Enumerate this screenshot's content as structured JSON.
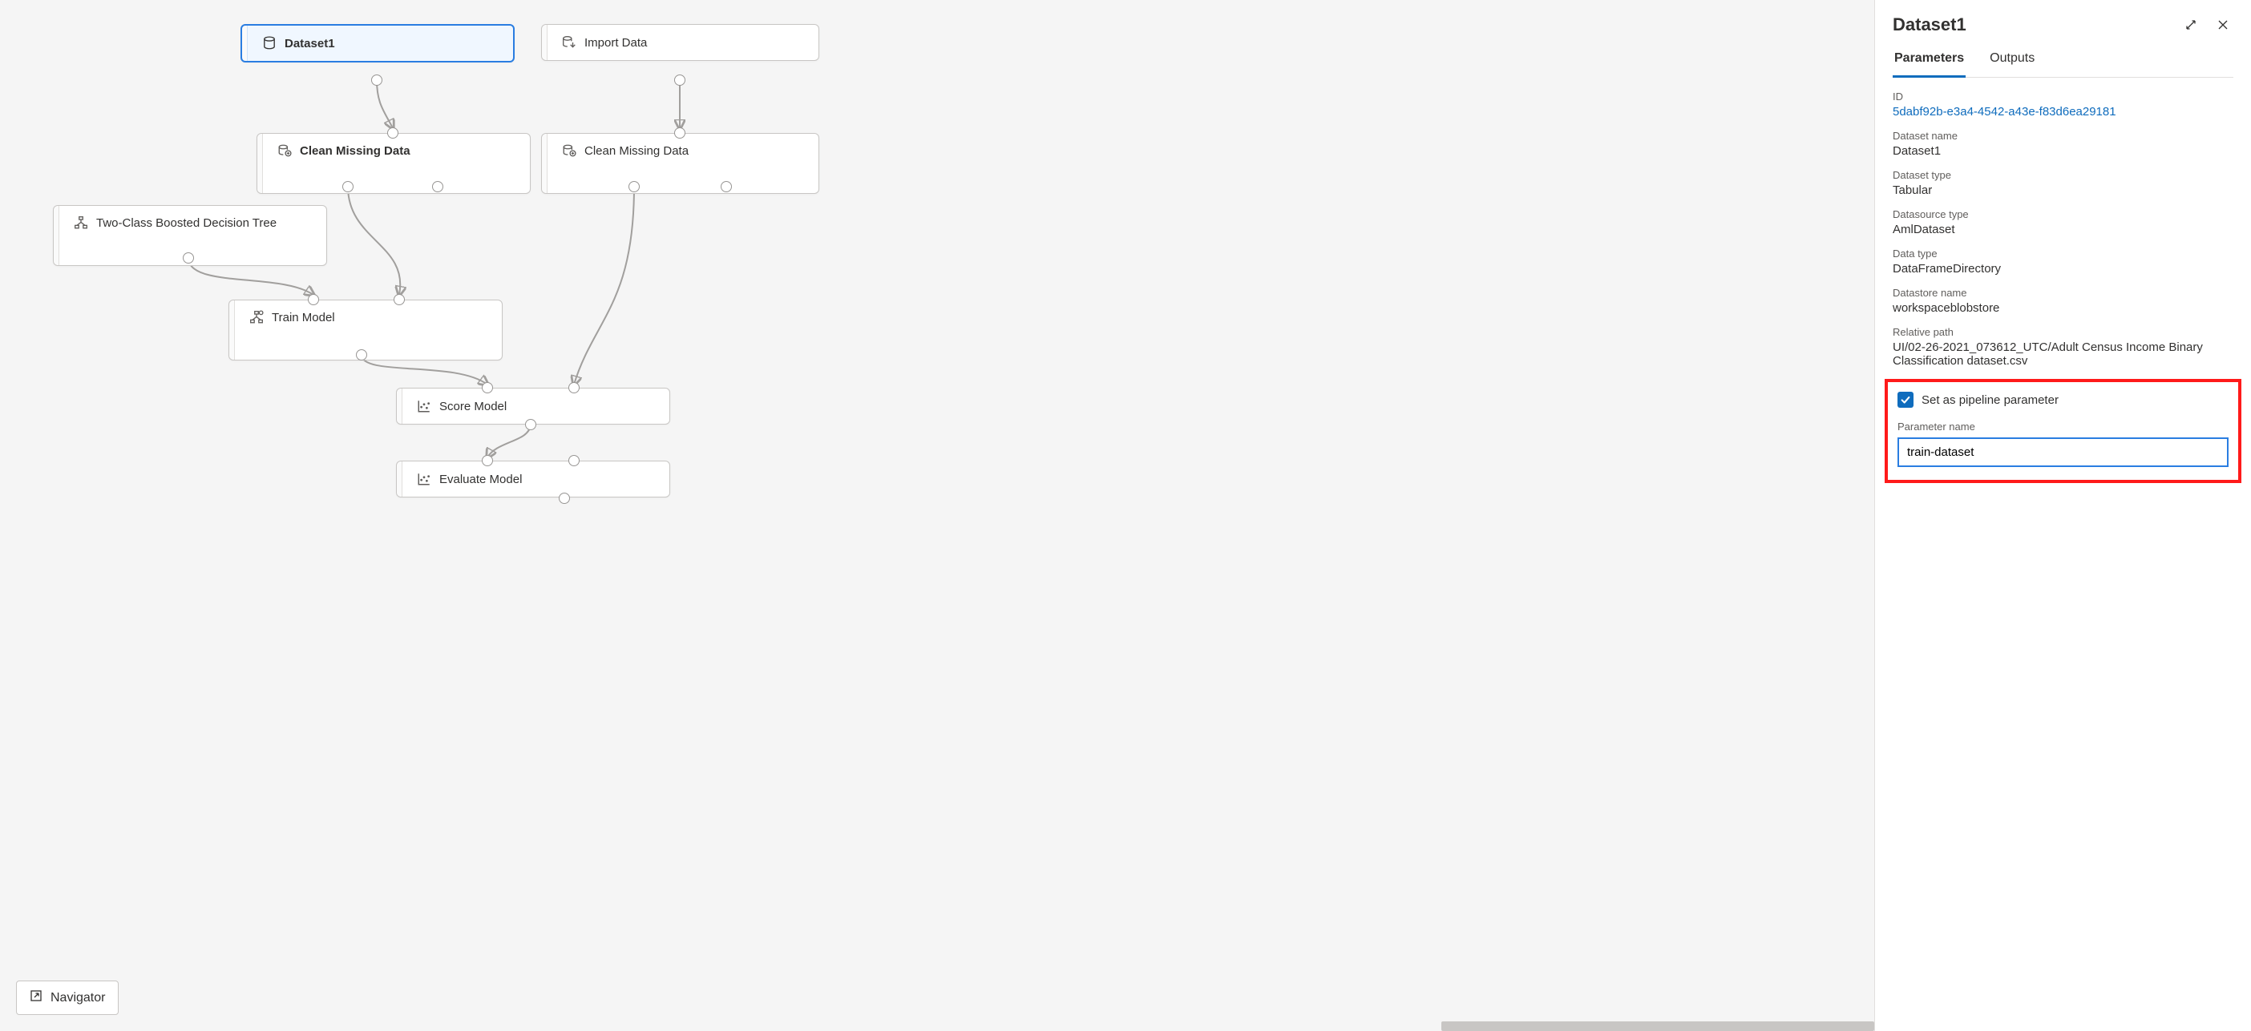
{
  "canvas": {
    "nodes": {
      "dataset1": {
        "label": "Dataset1",
        "icon": "dataset"
      },
      "importData": {
        "label": "Import Data",
        "icon": "import"
      },
      "cleanLeft": {
        "label": "Clean Missing Data",
        "icon": "clean"
      },
      "cleanRight": {
        "label": "Clean Missing Data",
        "icon": "clean"
      },
      "twoClass": {
        "label": "Two-Class Boosted Decision Tree",
        "icon": "tree"
      },
      "trainModel": {
        "label": "Train Model",
        "icon": "train"
      },
      "scoreModel": {
        "label": "Score Model",
        "icon": "chart"
      },
      "evalModel": {
        "label": "Evaluate Model",
        "icon": "chart"
      }
    },
    "navigator_label": "Navigator"
  },
  "panel": {
    "title": "Dataset1",
    "tabs": {
      "parameters": "Parameters",
      "outputs": "Outputs"
    },
    "props": {
      "id": {
        "k": "ID",
        "v": "5dabf92b-e3a4-4542-a43e-f83d6ea29181"
      },
      "datasetName": {
        "k": "Dataset name",
        "v": "Dataset1"
      },
      "datasetType": {
        "k": "Dataset type",
        "v": "Tabular"
      },
      "datasourceType": {
        "k": "Datasource type",
        "v": "AmlDataset"
      },
      "dataType": {
        "k": "Data type",
        "v": "DataFrameDirectory"
      },
      "datastoreName": {
        "k": "Datastore name",
        "v": "workspaceblobstore"
      },
      "relativePath": {
        "k": "Relative path",
        "v": "UI/02-26-2021_073612_UTC/Adult Census Income Binary Classification dataset.csv"
      }
    },
    "pipelineParam": {
      "checkbox_label": "Set as pipeline parameter",
      "name_label": "Parameter name",
      "name_value": "train-dataset"
    }
  }
}
